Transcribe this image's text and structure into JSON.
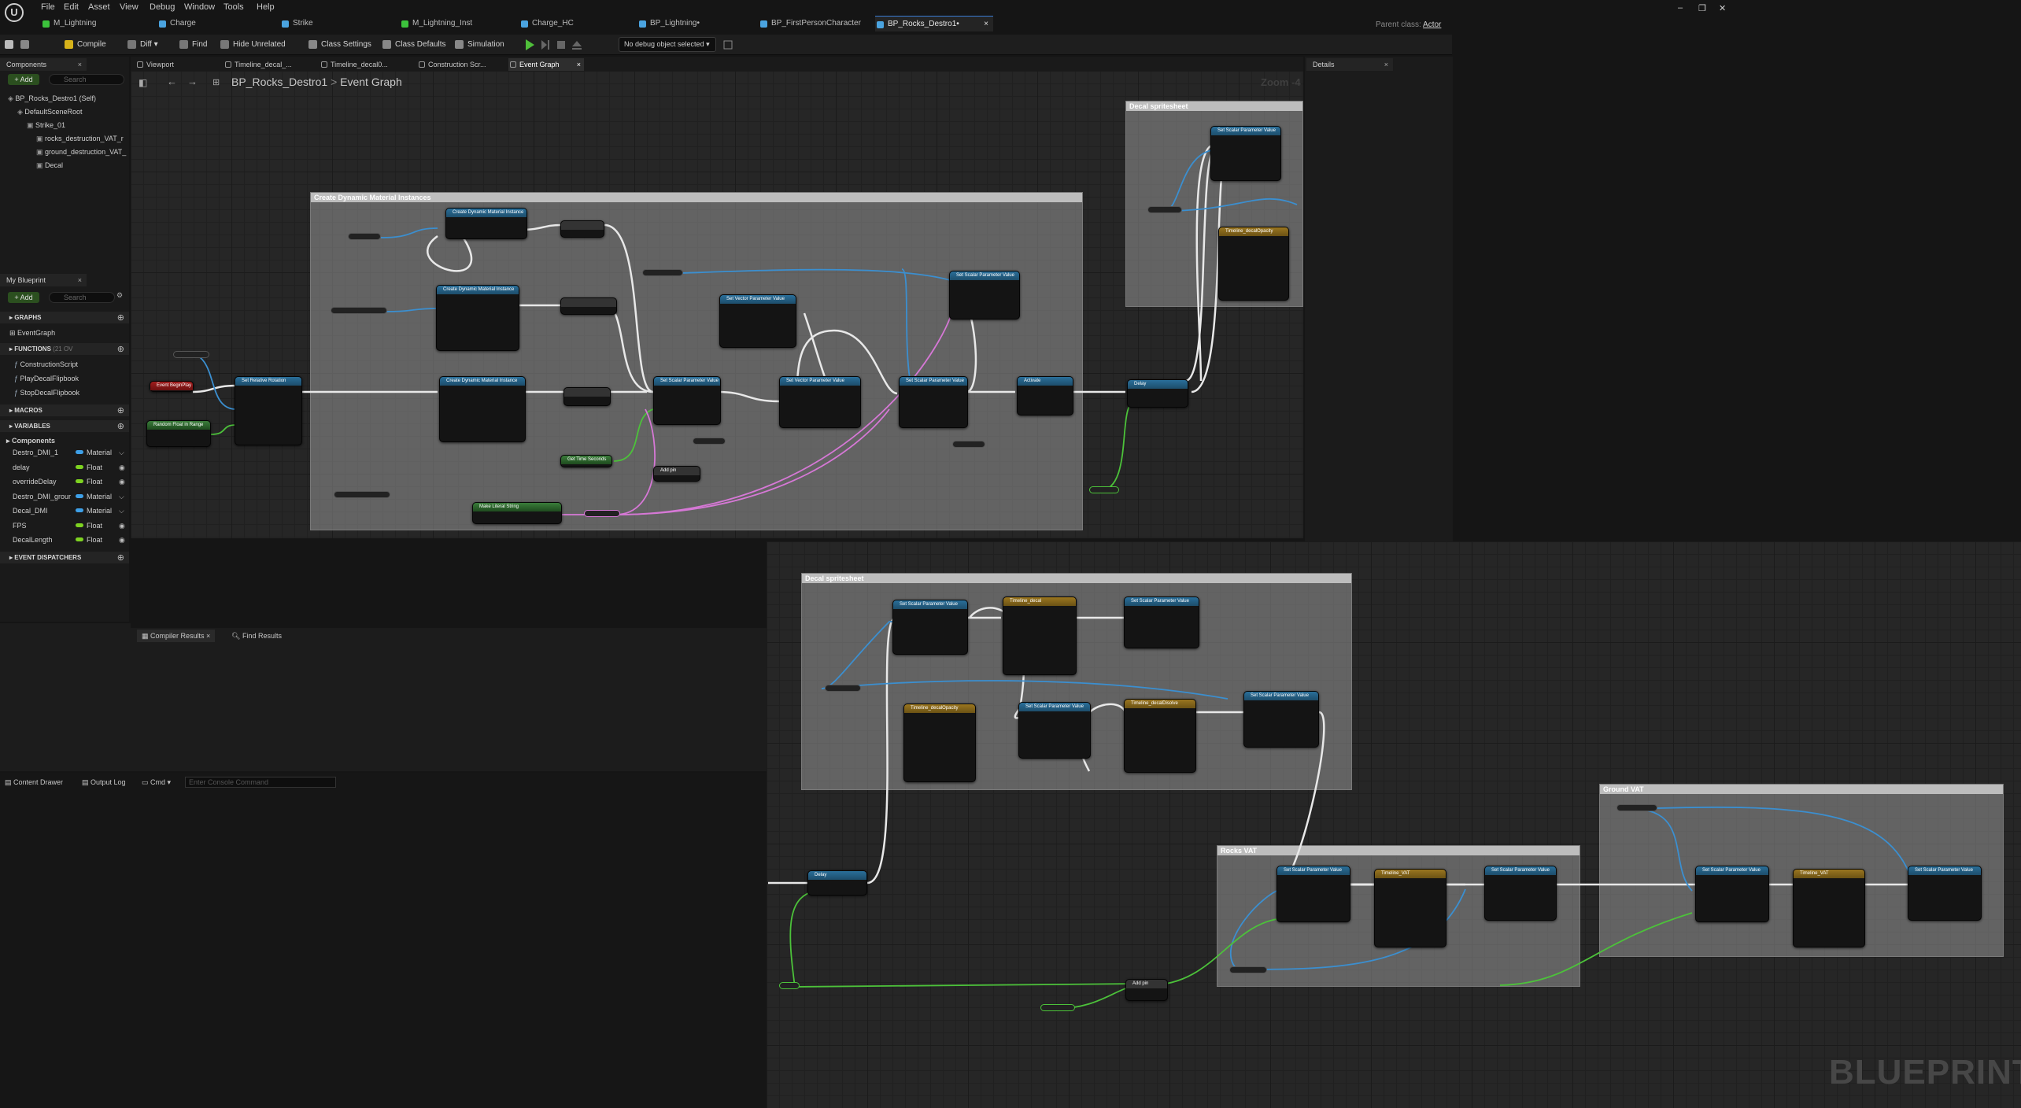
{
  "menu": [
    "File",
    "Edit",
    "Asset",
    "View",
    "Debug",
    "Window",
    "Tools",
    "Help"
  ],
  "logo_text": "U",
  "window_controls": {
    "minimize": "–",
    "restore": "❐",
    "close": "✕"
  },
  "parent_class": {
    "label": "Parent class:",
    "value": "Actor"
  },
  "doc_tabs": [
    {
      "label": "M_Lightning",
      "color": "#3cc23c"
    },
    {
      "label": "Charge",
      "color": "#4aa3df"
    },
    {
      "label": "Strike",
      "color": "#4aa3df"
    },
    {
      "label": "M_Lightning_Inst",
      "color": "#3cc23c"
    },
    {
      "label": "Charge_HC",
      "color": "#4aa3df"
    },
    {
      "label": "BP_Lightning•",
      "color": "#4aa3df"
    },
    {
      "label": "BP_FirstPersonCharacter",
      "color": "#4aa3df"
    },
    {
      "label": "BP_Rocks_Destro1•",
      "color": "#4aa3df"
    }
  ],
  "doc_tab_close": "×",
  "toolbar": {
    "compile": "Compile",
    "diff": "Diff",
    "find": "Find",
    "hide_unrelated": "Hide Unrelated",
    "class_settings": "Class Settings",
    "class_defaults": "Class Defaults",
    "simulation": "Simulation",
    "debug_object": "No debug object selected"
  },
  "components": {
    "title": "Components",
    "add": "+ Add",
    "search_placeholder": "Search",
    "tree": [
      {
        "label": "BP_Rocks_Destro1 (Self)",
        "indent": 0
      },
      {
        "label": "DefaultSceneRoot",
        "indent": 1
      },
      {
        "label": "Strike_01",
        "indent": 2
      },
      {
        "label": "rocks_destruction_VAT_r",
        "indent": 3
      },
      {
        "label": "ground_destruction_VAT_",
        "indent": 3
      },
      {
        "label": "Decal",
        "indent": 3
      }
    ]
  },
  "my_blueprint": {
    "title": "My Blueprint",
    "add": "+ Add",
    "search_placeholder": "Search",
    "graphs_header": "GRAPHS",
    "event_graph": "EventGraph",
    "functions_header": "FUNCTIONS",
    "functions_count": "(21 OV",
    "functions": [
      "ConstructionScript",
      "PlayDecalFlipbook",
      "StopDecalFlipbook"
    ],
    "macros_header": "MACROS",
    "variables_header": "VARIABLES",
    "components_group": "Components",
    "variables": [
      {
        "name": "Destro_DMI_1",
        "type": "Material",
        "color": "#3ea0e8"
      },
      {
        "name": "delay",
        "type": "Float",
        "color": "#7ed321"
      },
      {
        "name": "overrideDelay",
        "type": "Float",
        "color": "#7ed321"
      },
      {
        "name": "Destro_DMI_grour",
        "type": "Material",
        "color": "#3ea0e8"
      },
      {
        "name": "Decal_DMI",
        "type": "Material",
        "color": "#3ea0e8"
      },
      {
        "name": "FPS",
        "type": "Float",
        "color": "#7ed321"
      },
      {
        "name": "DecalLength",
        "type": "Float",
        "color": "#7ed321"
      }
    ],
    "dispatchers_header": "EVENT DISPATCHERS"
  },
  "graph_tabs": [
    "Viewport",
    "Timeline_decal_...",
    "Timeline_decal0...",
    "Construction Scr...",
    "Event Graph"
  ],
  "breadcrumb": {
    "blueprint": "BP_Rocks_Destro1",
    "separator": ">",
    "graph": "Event Graph"
  },
  "zoom": "Zoom -4",
  "details": {
    "title": "Details"
  },
  "results_tabs": {
    "compiler": "Compiler Results",
    "find": "Find Results"
  },
  "bottom_bar": {
    "content_drawer": "Content Drawer",
    "output_log": "Output Log",
    "cmd": "Cmd",
    "console_placeholder": "Enter Console Command"
  },
  "comments": {
    "dmi": "Create Dynamic Material Instances",
    "decal_top": "Decal spritesheet",
    "decal_bottom": "Decal spritesheet",
    "ground": "Ground VAT",
    "rocks": "Rocks VAT"
  },
  "nodes": {
    "event_begin": "Event BeginPlay",
    "set_relative_rotation": "Set Relative Rotation",
    "create_dmi": "Create Dynamic Material Instance",
    "set_scalar": "Set Scalar Parameter Value",
    "set_vector": "Set Vector Parameter Value",
    "activate": "Activate",
    "delay": "Delay",
    "timeline_decal": "Timeline_decal",
    "timeline_decalopacity": "Timeline_decalOpacity",
    "timeline_decaldisolve": "Timeline_decalDisolve",
    "timeline_vat": "Timeline_VAT",
    "random_float": "Random Float in Range",
    "set_time_seconds": "Get Time Seconds",
    "make_literal": "Make Literal String",
    "add_pin": "Add pin"
  },
  "watermark": "BLUEPRINT"
}
